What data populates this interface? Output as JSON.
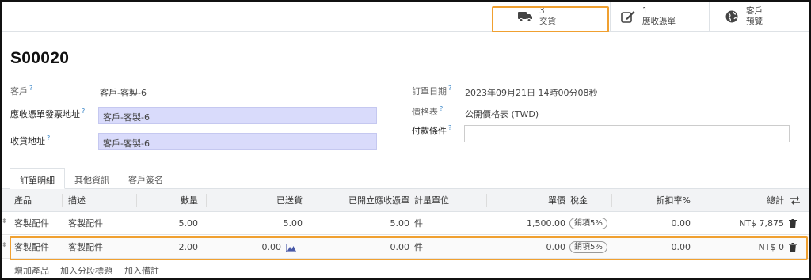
{
  "stat_buttons": [
    {
      "count": "3",
      "label": "交貨",
      "icon": "truck-icon"
    },
    {
      "count": "1",
      "label": "應收憑單",
      "icon": "edit-icon"
    },
    {
      "count": "客戶",
      "label": "預覽",
      "icon": "globe-icon"
    }
  ],
  "record": {
    "name": "S00020"
  },
  "form": {
    "customer_label": "客戶",
    "customer_value": "客戶-客製-6",
    "invoice_addr_label": "應收憑單發票地址",
    "invoice_addr_value": "客戶-客製-6",
    "delivery_addr_label": "收貨地址",
    "delivery_addr_value": "客戶-客製-6",
    "order_date_label": "訂單日期",
    "order_date_value": "2023年09月21日 14時00分08秒",
    "pricelist_label": "價格表",
    "pricelist_value": "公開價格表 (TWD)",
    "payment_terms_label": "付款條件",
    "payment_terms_value": "",
    "help_mark": "?"
  },
  "tabs": [
    "訂單明細",
    "其他資訊",
    "客戶簽名"
  ],
  "table": {
    "headers": {
      "product": "產品",
      "description": "描述",
      "quantity": "數量",
      "delivered": "已送貨",
      "invoiced": "已開立應收憑單",
      "uom": "計量單位",
      "unit_price": "單價",
      "taxes": "稅金",
      "discount": "折扣率%",
      "subtotal": "總計"
    },
    "rows": [
      {
        "product": "客製配件",
        "description": "客製配件",
        "quantity": "5.00",
        "delivered": "5.00",
        "invoiced": "5.00",
        "uom": "件",
        "unit_price": "1,500.00",
        "tax": "銷項5%",
        "discount": "0.00",
        "subtotal": "NT$ 7,875"
      },
      {
        "product": "客製配件",
        "description": "客製配件",
        "quantity": "2.00",
        "delivered": "0.00",
        "invoiced": "0.00",
        "uom": "件",
        "unit_price": "0.00",
        "tax": "銷項5%",
        "discount": "0.00",
        "subtotal": "NT$ 0"
      }
    ]
  },
  "add_links": [
    "增加產品",
    "加入分段標題",
    "加入備註"
  ],
  "colors": {
    "highlight": "#f0a030",
    "field_bg": "#d9dbfb",
    "help": "#3a86c8"
  }
}
